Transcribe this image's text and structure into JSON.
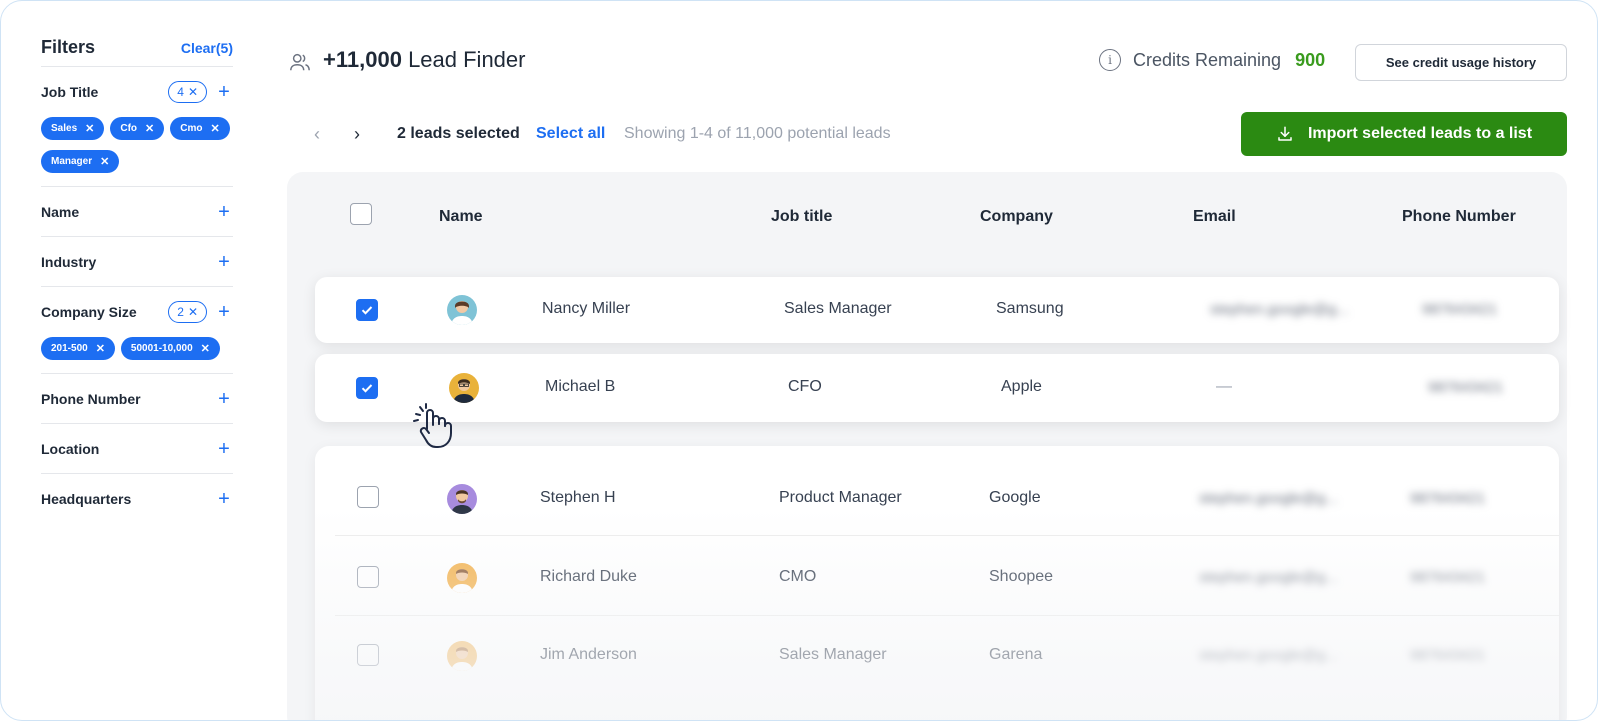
{
  "sidebar": {
    "title": "Filters",
    "clear_label": "Clear(5)",
    "sections": {
      "job_title": {
        "label": "Job Title",
        "count": "4",
        "chips": [
          "Sales",
          "Cfo",
          "Cmo",
          "Manager"
        ]
      },
      "name": {
        "label": "Name"
      },
      "industry": {
        "label": "Industry"
      },
      "company_size": {
        "label": "Company Size",
        "count": "2",
        "chips": [
          "201-500",
          "50001-10,000"
        ]
      },
      "phone_number": {
        "label": "Phone Number"
      },
      "location": {
        "label": "Location"
      },
      "headquarters": {
        "label": "Headquarters"
      }
    },
    "plus_symbol": "+",
    "remove_symbol": "✕"
  },
  "header": {
    "title_bold": "+11,000",
    "title_rest": "Lead Finder",
    "credits_label": "Credits Remaining",
    "credits_value": "900",
    "history_button": "See credit usage history"
  },
  "toolbar": {
    "prev": "‹",
    "next": "›",
    "selected": "2 leads selected",
    "select_all": "Select all",
    "showing": "Showing 1-4 of 11,000 potential leads",
    "import_button": "Import selected leads to a list"
  },
  "table": {
    "columns": [
      "Name",
      "Job title",
      "Company",
      "Email",
      "Phone Number"
    ],
    "rows": [
      {
        "name": "Nancy Miller",
        "job": "Sales Manager",
        "company": "Samsung",
        "email": "stephen.google@g...",
        "phone": "987643421",
        "checked": true
      },
      {
        "name": "Michael B",
        "job": "CFO",
        "company": "Apple",
        "email": "—",
        "phone": "987643421",
        "checked": true
      },
      {
        "name": "Stephen H",
        "job": "Product Manager",
        "company": "Google",
        "email": "stephen.google@g...",
        "phone": "987643421",
        "checked": false
      },
      {
        "name": "Richard Duke",
        "job": "CMO",
        "company": "Shoopee",
        "email": "stephen.google@g...",
        "phone": "987643421",
        "checked": false
      },
      {
        "name": "Jim Anderson",
        "job": "Sales Manager",
        "company": "Garena",
        "email": "stephen.google@g...",
        "phone": "987643421",
        "checked": false
      }
    ]
  },
  "colors": {
    "accent": "#1d6ef2",
    "import_green": "#2b8a12",
    "credits_green": "#3a9b1e"
  },
  "icons": [
    "users-icon",
    "info-icon",
    "download-icon",
    "pointer-hand-icon",
    "check-icon"
  ]
}
